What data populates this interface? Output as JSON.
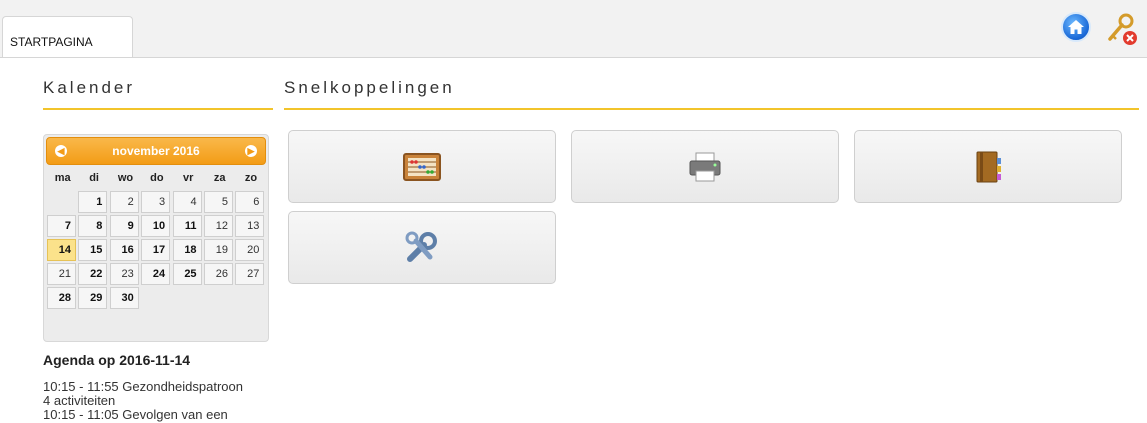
{
  "tabs": [
    {
      "label": "STARTPAGINA"
    }
  ],
  "top_icons": [
    "home-icon",
    "key-logout-icon"
  ],
  "calendar": {
    "section_title": "Kalender",
    "month_label": "november 2016",
    "weekdays": [
      "ma",
      "di",
      "wo",
      "do",
      "vr",
      "za",
      "zo"
    ],
    "weeks": [
      [
        "",
        "1",
        "2",
        "3",
        "4",
        "5",
        "6"
      ],
      [
        "7",
        "8",
        "9",
        "10",
        "11",
        "12",
        "13"
      ],
      [
        "14",
        "15",
        "16",
        "17",
        "18",
        "19",
        "20"
      ],
      [
        "21",
        "22",
        "23",
        "24",
        "25",
        "26",
        "27"
      ],
      [
        "28",
        "29",
        "30",
        "",
        "",
        "",
        ""
      ]
    ],
    "bold_days": [
      "1",
      "7",
      "8",
      "9",
      "10",
      "11",
      "14",
      "15",
      "16",
      "17",
      "18",
      "22",
      "24",
      "25",
      "28",
      "29",
      "30"
    ],
    "today": "14"
  },
  "agenda": {
    "title": "Agenda op 2016-11-14",
    "entries": [
      "10:15 - 11:55 Gezondheidspatroon",
      "4 activiteiten",
      "10:15 - 11:05 Gevolgen van een"
    ]
  },
  "shortcuts": {
    "section_title": "Snelkoppelingen",
    "tiles": [
      {
        "icon": "abacus-icon"
      },
      {
        "icon": "printer-icon"
      },
      {
        "icon": "address-book-icon"
      },
      {
        "icon": "wrench-tools-icon"
      }
    ]
  },
  "colors": {
    "accent": "#f2c42b",
    "calendar_header": "#f39c16",
    "today": "#fbe28b"
  }
}
